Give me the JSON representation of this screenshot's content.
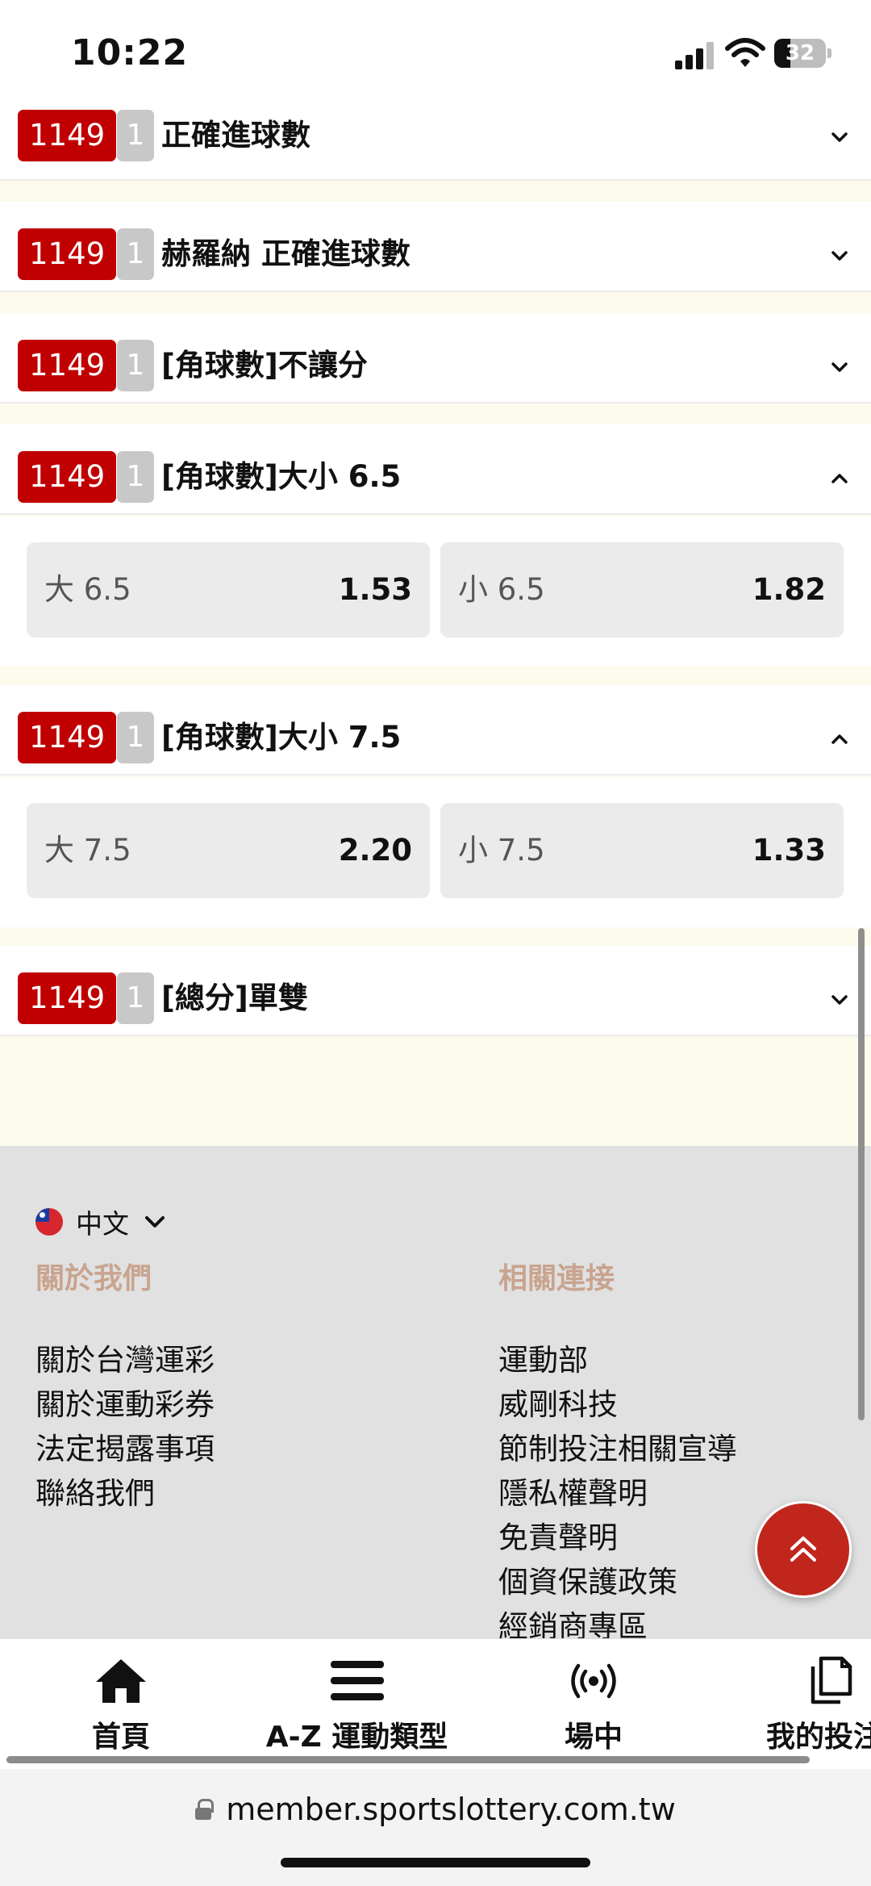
{
  "status_bar": {
    "time": "10:22",
    "battery": "32"
  },
  "markets": [
    {
      "id": "1149",
      "num": "1",
      "title": "正確進球數",
      "expanded": false
    },
    {
      "id": "1149",
      "num": "1",
      "title": "赫羅納 正確進球數",
      "expanded": false
    },
    {
      "id": "1149",
      "num": "1",
      "title": "[角球數]不讓分",
      "expanded": false
    },
    {
      "id": "1149",
      "num": "1",
      "title": "[角球數]大小 6.5",
      "expanded": true,
      "odds": [
        {
          "label": "大 6.5",
          "value": "1.53"
        },
        {
          "label": "小 6.5",
          "value": "1.82"
        }
      ]
    },
    {
      "id": "1149",
      "num": "1",
      "title": "[角球數]大小 7.5",
      "expanded": true,
      "odds": [
        {
          "label": "大 7.5",
          "value": "2.20"
        },
        {
          "label": "小 7.5",
          "value": "1.33"
        }
      ]
    },
    {
      "id": "1149",
      "num": "1",
      "title": "[總分]單雙",
      "expanded": false
    }
  ],
  "footer": {
    "language": "中文",
    "about": {
      "title": "關於我們",
      "links": [
        "關於台灣運彩",
        "關於運動彩券",
        "法定揭露事項",
        "聯絡我們"
      ]
    },
    "related": {
      "title": "相關連接",
      "links": [
        "運動部",
        "威剛科技",
        "節制投注相關宣導",
        "隱私權聲明",
        "免責聲明",
        "個資保護政策",
        "經銷商專區"
      ]
    }
  },
  "bottom_nav": [
    {
      "label": "首頁",
      "icon": "home-icon"
    },
    {
      "label": "A-Z 運動類型",
      "icon": "menu-icon"
    },
    {
      "label": "場中",
      "icon": "live-broadcast-icon"
    },
    {
      "label": "我的投注",
      "icon": "documents-icon"
    }
  ],
  "browser": {
    "url": "member.sportslottery.com.tw"
  },
  "colors": {
    "brand_red": "#c00000",
    "footer_title": "#c9a48f",
    "fab": "#c0261c"
  }
}
